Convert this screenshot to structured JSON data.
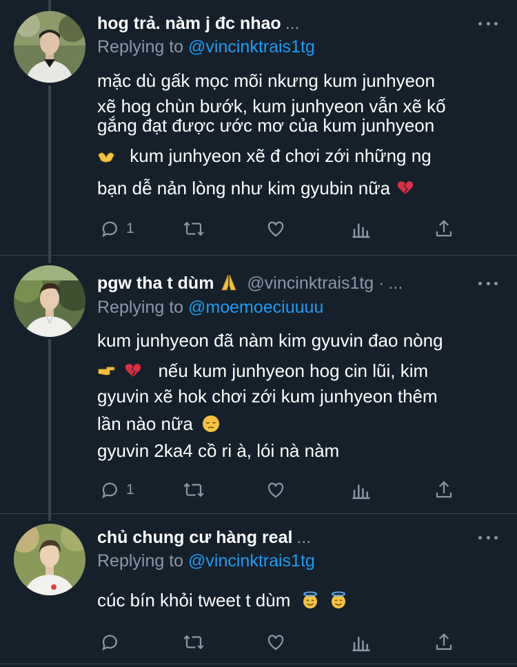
{
  "colors": {
    "background": "#15202b",
    "text_primary": "#ffffff",
    "text_secondary": "#8b98a5",
    "link": "#1d9bf0",
    "divider": "#38444d"
  },
  "replying_prefix": "Replying to",
  "tweets": [
    {
      "display_name": "hog trả. nàm j đc nhao",
      "handle": "",
      "ellipsis": "...",
      "reply_to": "@vincinktrais1tg",
      "lines": [
        "mặc dù gấk mọc mõi nkưng kum junhyeon",
        "xẽ hog chùn bướk, kum junhyeon vẫn xẽ kố",
        "gắng đạt được ước mơ của kum junhyeon",
        "kum junhyeon xẽ đ chơi zới những ng",
        "bạn dễ nản lòng như kim gyubin nữa"
      ],
      "reply_count": "1",
      "icons": [
        "reply-icon",
        "retweet-icon",
        "like-icon",
        "analytics-icon",
        "share-icon"
      ]
    },
    {
      "display_name": "pgw tha t dùm",
      "handle": "@vincinktrais1tg ·",
      "ellipsis": "...",
      "reply_to": "@moemoeciuuuu",
      "lines": [
        "kum junhyeon đã nàm kim gyuvin đao nòng",
        "nếu kum junhyeon hog cin lũi, kim",
        "gyuvin xẽ hok chơi zới kum junhyeon thêm",
        "lần nào nữa",
        "gyuvin 2ka4 cồ ri à, lói nà nàm"
      ],
      "reply_count": "1",
      "icons": [
        "reply-icon",
        "retweet-icon",
        "like-icon",
        "analytics-icon",
        "share-icon"
      ]
    },
    {
      "display_name": "chủ chung cư hàng real",
      "handle": "",
      "ellipsis": "...",
      "reply_to": "@vincinktrais1tg",
      "lines": [
        "cúc bín khỏi tweet t dùm"
      ],
      "reply_count": "",
      "icons": [
        "reply-icon",
        "retweet-icon",
        "like-icon",
        "analytics-icon",
        "share-icon"
      ]
    }
  ],
  "emojis": {
    "hands": "hands-emoji",
    "broken_heart": "broken-heart-emoji",
    "pray": "pray-emoji",
    "point_right": "point-right-emoji",
    "pensive": "pensive-emoji",
    "halo": "smiling-halo-emoji"
  }
}
